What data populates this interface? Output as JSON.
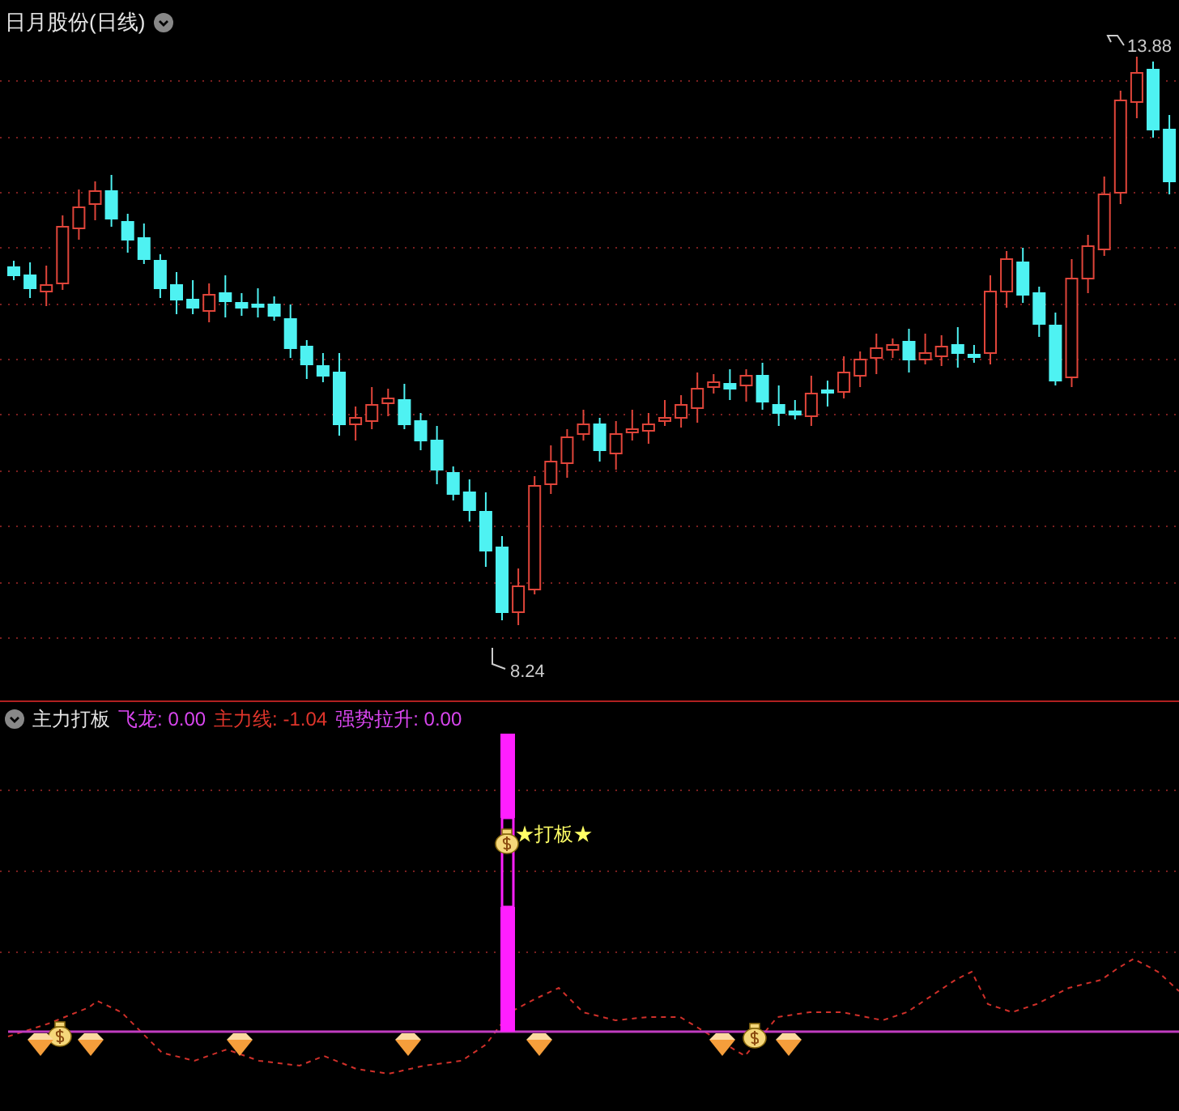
{
  "chart": {
    "title": "日月股份(日线)",
    "high_label": "13.88",
    "low_label": "8.24"
  },
  "indicator": {
    "name": "主力打板",
    "legends": [
      {
        "label": "飞龙:",
        "value": "0.00",
        "color": "#d946ef"
      },
      {
        "label": "主力线:",
        "value": "-1.04",
        "color": "#e0352b"
      },
      {
        "label": "强势拉升:",
        "value": "0.00",
        "color": "#d946ef"
      }
    ],
    "signal_label": "★打板★"
  }
}
